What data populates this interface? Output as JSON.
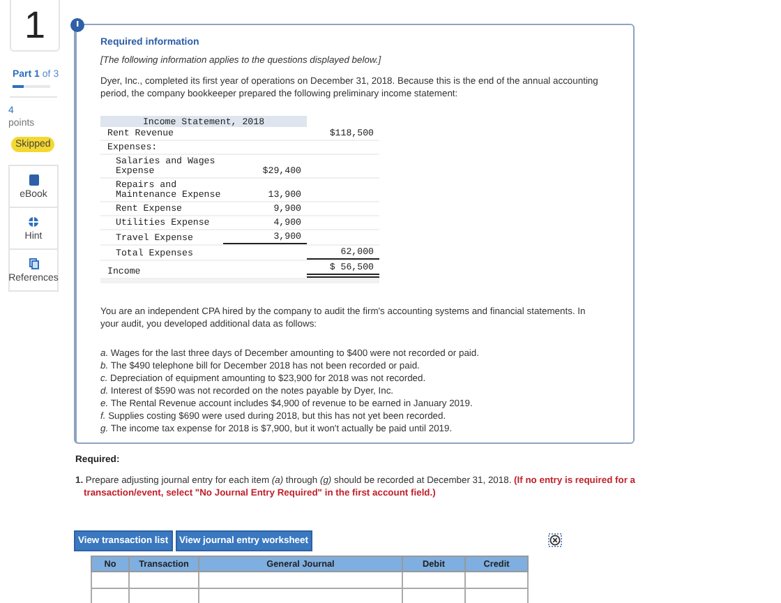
{
  "sidebar": {
    "question_number": "1",
    "part": "**Part 1** of 3",
    "progress": {
      "level": 0.3
    },
    "points": "4",
    "points_label": "points",
    "status": "Skipped",
    "tools": [
      {
        "kind": "book",
        "label": "eBook"
      },
      {
        "kind": "hint",
        "label": "Hint"
      },
      {
        "kind": "references",
        "label": "References"
      }
    ]
  },
  "info": {
    "title": "Required information",
    "note": "[The following information applies to the questions displayed below.]",
    "intro": "Dyer, Inc., completed its first year of operations on December 31, 2018. Because this is the end of the annual accounting period, the company bookkeeper prepared the following preliminary income statement:",
    "income_statement": {
      "title": "Income Statement, 2018",
      "rows": [
        {
          "label": "Rent Revenue",
          "amount_2": "$118,500"
        },
        {
          "label": "Expenses:",
          "children": [
            {
              "label": "Salaries and Wages Expense",
              "amount_1": "$29,400"
            },
            {
              "label": "Repairs and Maintenance Expense",
              "amount_1": "13,900"
            },
            {
              "label": "Rent Expense",
              "amount_1": "9,900"
            },
            {
              "label": "Utilities Expense",
              "amount_1": "4,900"
            },
            {
              "label": "Travel Expense",
              "amount_1": "3,900",
              "underline_1": true
            },
            {
              "label": "Total Expenses",
              "amount_2": "62,000",
              "underline_2": true
            }
          ]
        },
        {
          "label": "Income",
          "amount_2": "$ 56,500",
          "double_underline_2": true
        }
      ]
    },
    "audit_text": "You are an independent CPA hired by the company to audit the firm's accounting systems and financial statements. In your audit, you developed additional data as follows:",
    "items": [
      "*a.* Wages for the last three days of December amounting to $400 were not recorded or paid.",
      "*b.* The $490 telephone bill for December 2018 has not been recorded or paid.",
      "*c.* Depreciation of equipment amounting to $23,900 for 2018 was not recorded.",
      "*d.* Interest of $590 was not recorded on the notes payable by Dyer, Inc.",
      "*e.* The Rental Revenue account includes $4,900 of revenue to be earned in January 2019.",
      "*f.* Supplies costing $690 were used during 2018, but this has not yet been recorded.",
      "*g.* The income tax expense for 2018 is $7,900, but it won't actually be paid until 2019."
    ]
  },
  "required": {
    "heading": "Required:",
    "instruction": "**1.** Prepare adjusting journal entry for each item *(a)* through *(g)* should be recorded at December 31, 2018.",
    "note": "(If no entry is required for a transaction/event, select \"No Journal Entry Required\" in the first account field.)"
  },
  "buttons": [
    "View transaction list",
    "View journal entry worksheet"
  ],
  "journal": {
    "columns": [
      "No",
      "Transaction",
      "General Journal",
      "Debit",
      "Credit"
    ]
  }
}
